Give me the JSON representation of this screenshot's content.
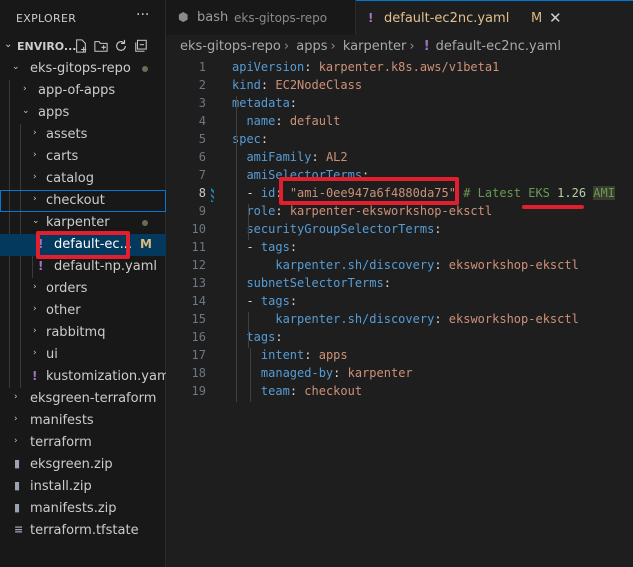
{
  "explorer": {
    "title": "EXPLORER",
    "more": "···",
    "root_label": "ENVIRO...",
    "items": [
      {
        "label": "eks-gitops-repo",
        "type": "folder",
        "open": true,
        "dot": true
      },
      {
        "label": "app-of-apps",
        "type": "folder",
        "open": false
      },
      {
        "label": "apps",
        "type": "folder",
        "open": true
      },
      {
        "label": "assets",
        "type": "folder",
        "open": false
      },
      {
        "label": "carts",
        "type": "folder",
        "open": false
      },
      {
        "label": "catalog",
        "type": "folder",
        "open": false
      },
      {
        "label": "checkout",
        "type": "folder",
        "open": false
      },
      {
        "label": "karpenter",
        "type": "folder",
        "open": true,
        "dot": true
      },
      {
        "label": "default-ec...",
        "type": "yaml",
        "badge": "M"
      },
      {
        "label": "default-np.yaml",
        "type": "yaml"
      },
      {
        "label": "orders",
        "type": "folder",
        "open": false
      },
      {
        "label": "other",
        "type": "folder",
        "open": false
      },
      {
        "label": "rabbitmq",
        "type": "folder",
        "open": false
      },
      {
        "label": "ui",
        "type": "folder",
        "open": false
      },
      {
        "label": "kustomization.yaml",
        "type": "yaml"
      },
      {
        "label": "eksgreen-terraform",
        "type": "folder",
        "open": false
      },
      {
        "label": "manifests",
        "type": "folder",
        "open": false
      },
      {
        "label": "terraform",
        "type": "folder",
        "open": false
      },
      {
        "label": "eksgreen.zip",
        "type": "zip"
      },
      {
        "label": "install.zip",
        "type": "zip"
      },
      {
        "label": "manifests.zip",
        "type": "zip"
      },
      {
        "label": "terraform.tfstate",
        "type": "file"
      }
    ]
  },
  "tabs": [
    {
      "label": "bash",
      "description": "eks-gitops-repo",
      "active": false
    },
    {
      "label": "default-ec2nc.yaml",
      "modified": "M",
      "active": true
    }
  ],
  "breadcrumb": [
    "eks-gitops-repo",
    "apps",
    "karpenter",
    "default-ec2nc.yaml"
  ],
  "editor": {
    "current_line": 8,
    "lines": [
      {
        "n": "1",
        "text": "apiVersion: karpenter.k8s.aws/v1beta1"
      },
      {
        "n": "2",
        "text": "kind: EC2NodeClass"
      },
      {
        "n": "3",
        "text": "metadata:"
      },
      {
        "n": "4",
        "text": "  name: default"
      },
      {
        "n": "5",
        "text": "spec:"
      },
      {
        "n": "6",
        "text": "  amiFamily: AL2"
      },
      {
        "n": "7",
        "text": "  amiSelectorTerms:"
      },
      {
        "n": "8",
        "text": "  - id: \"ami-0ee947a6f4880da75\" # Latest EKS 1.26 AMI"
      },
      {
        "n": "9",
        "text": "  role: karpenter-eksworkshop-eksctl"
      },
      {
        "n": "10",
        "text": "  securityGroupSelectorTerms:"
      },
      {
        "n": "11",
        "text": "  - tags:"
      },
      {
        "n": "12",
        "text": "      karpenter.sh/discovery: eksworkshop-eksctl"
      },
      {
        "n": "13",
        "text": "  subnetSelectorTerms:"
      },
      {
        "n": "14",
        "text": "  - tags:"
      },
      {
        "n": "15",
        "text": "      karpenter.sh/discovery: eksworkshop-eksctl"
      },
      {
        "n": "16",
        "text": "  tags:"
      },
      {
        "n": "17",
        "text": "    intent: apps"
      },
      {
        "n": "18",
        "text": "    managed-by: karpenter"
      },
      {
        "n": "19",
        "text": "    team: checkout"
      }
    ]
  },
  "colors": {
    "key": "#569cd6",
    "string": "#ce9178",
    "comment": "#6a9955",
    "annotation": "#e21f2f",
    "accent": "#0078d4",
    "modified": "#d7ba7d"
  }
}
